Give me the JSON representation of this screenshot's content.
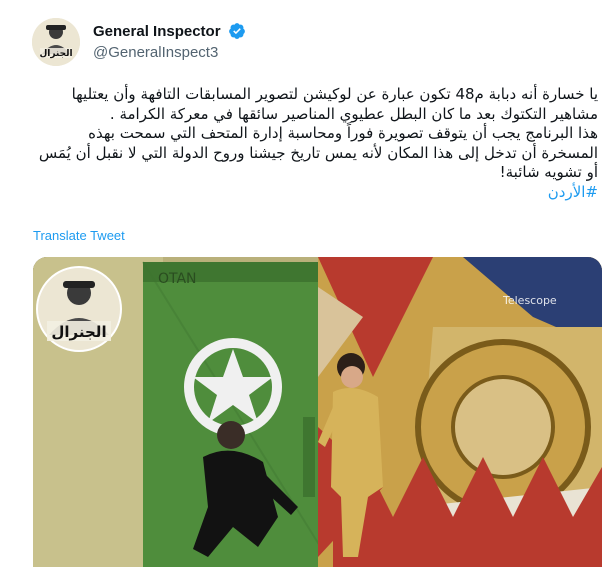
{
  "author": {
    "display_name": "General Inspector",
    "handle": "@GeneralInspect3",
    "verified": true,
    "avatar_caption": "الجنرال"
  },
  "tweet": {
    "paragraphs": [
      "يا خسارة أنه دبابة م48 تكون عبارة عن لوكيشن لتصوير المسابقات التافهة وأن يعتليها مشاهير التكتوك بعد ما كان البطل عطيوي المناصير سائقها في معركة الكرامة .",
      "هذا البرنامج يجب أن يتوقف تصويرة فوراً ومحاسبة إدارة المتحف التي سمحت بهذه المسخرة أن تدخل إلى هذا المكان لأنه يمس تاريخ جيشنا وروح الدولة التي لا نقبل أن يُمَس أو تشويه شائبة!"
    ],
    "hashtag": "#الأردن"
  },
  "translate_label": "Translate Tweet",
  "media": {
    "watermark_text": "الجنرال",
    "scene_text_left": "OTAN",
    "scene_text_right": "Telescope"
  },
  "colors": {
    "link": "#1d9bf0",
    "verified": "#1d9bf0",
    "secondary_text": "#536471"
  }
}
